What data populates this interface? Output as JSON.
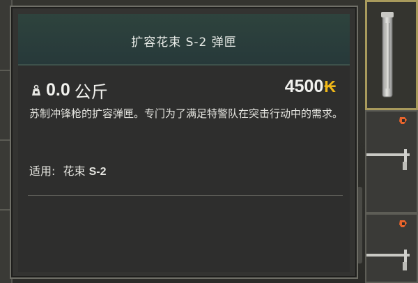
{
  "tooltip": {
    "title": "扩容花束 S-2 弹匣",
    "weight_value": "0.0",
    "weight_unit": "公斤",
    "price": "4500",
    "currency_symbol": "₭",
    "description": "苏制冲锋枪的扩容弹匣。专门为了满足特警队在突击行动中的需求。",
    "compat_label": "适用:",
    "compat_name": "花束",
    "compat_model": "S-2"
  },
  "icons": {
    "weight": "weight-icon",
    "tag": "orange-tag-icon"
  },
  "colors": {
    "currency": "#f0b818",
    "header": "#2e433d",
    "tag": "#e8642c",
    "selected_border": "#a89a5c"
  }
}
